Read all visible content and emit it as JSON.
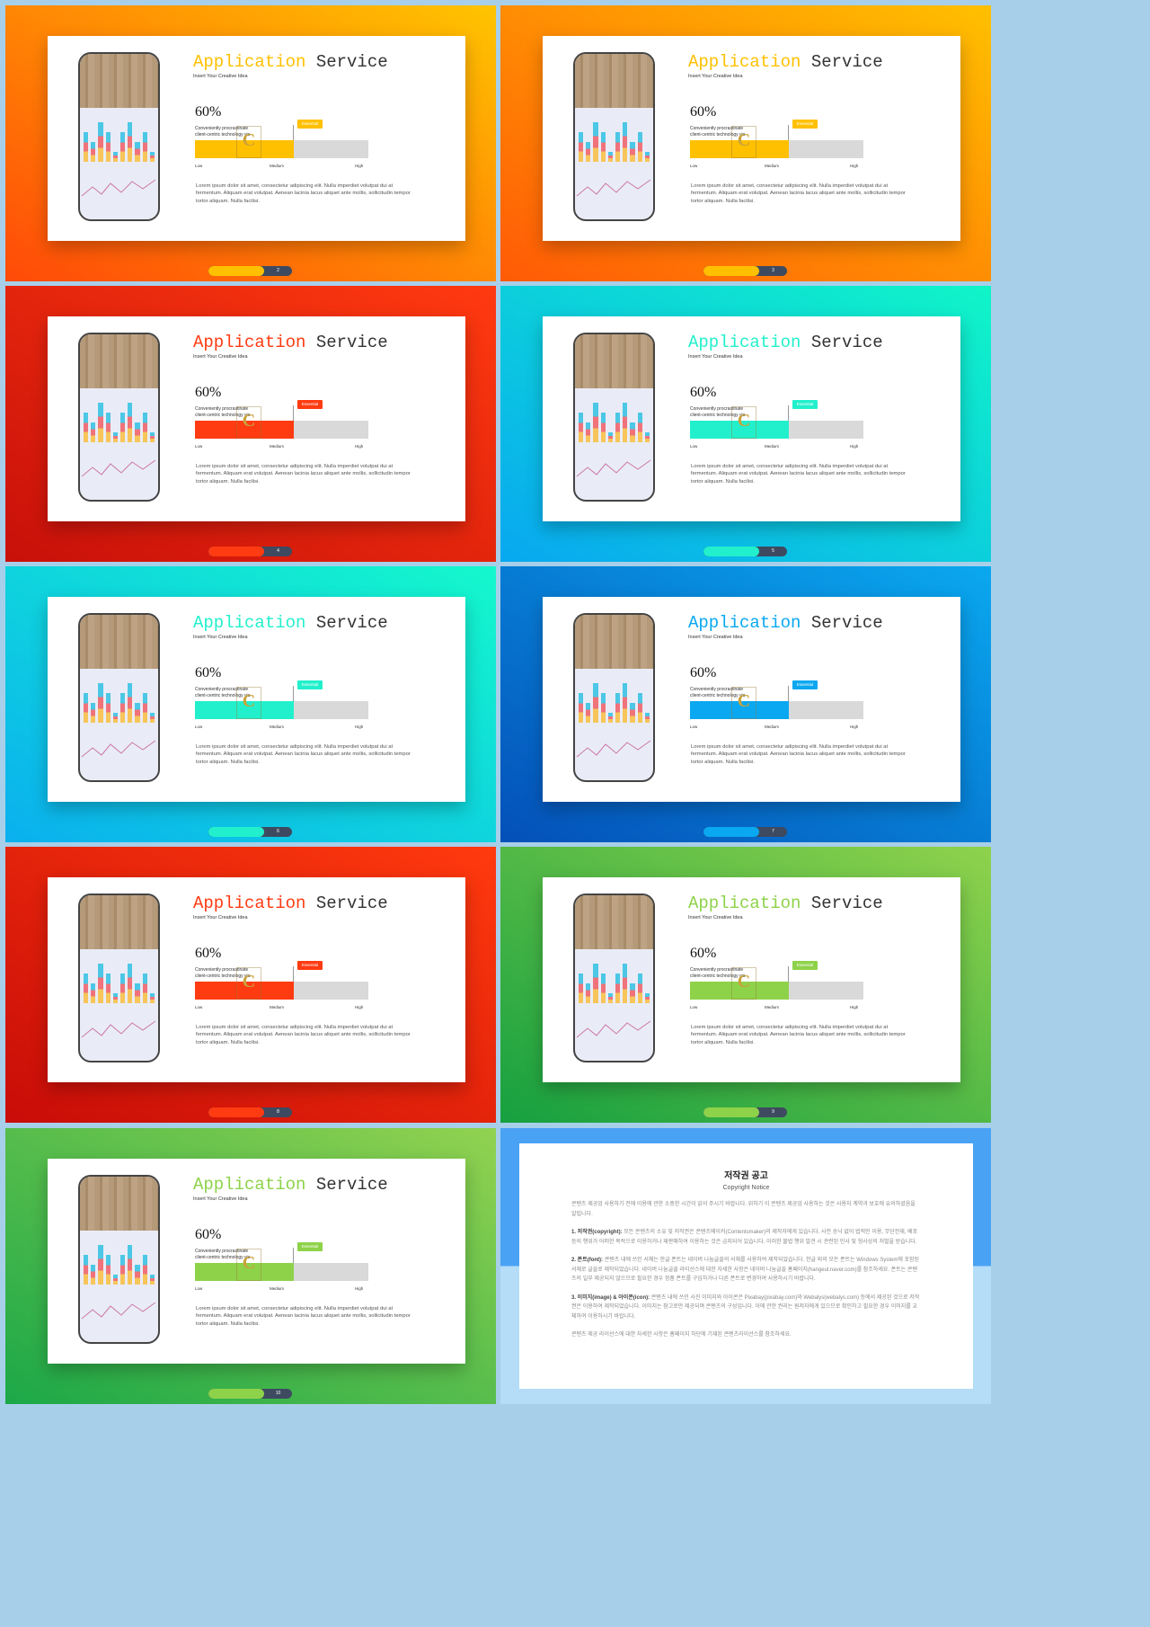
{
  "slide_template": {
    "title_accent": "Application",
    "title_rest": " Service",
    "subtitle": "Insert Your Creative Idea",
    "percent": "60%",
    "progress_percent": 57,
    "description": "Conveniently procrastinate client-centric technology via",
    "badge": "Essential",
    "scale_low": "Low",
    "scale_medium": "Medium",
    "scale_high": "High",
    "body": "Lorem ipsum dolor sit amet, consectetur adipiscing elit. Nulla imperdiet volutpat dui at fermentum. Aliquam erat volutpat. Aenean lacinia lacus aliquet ante mollis, sollicitudin tempor tortor aliquam. Nulla facilisi."
  },
  "slides": [
    {
      "page": "2",
      "accent": "#ffc000",
      "bg": [
        "#ff4a08",
        "#ffc400"
      ]
    },
    {
      "page": "3",
      "accent": "#ffc000",
      "bg": [
        "#ff5a06",
        "#ffc000"
      ]
    },
    {
      "page": "4",
      "accent": "#ff3b12",
      "bg": [
        "#c8100a",
        "#ff3a10"
      ]
    },
    {
      "page": "5",
      "accent": "#22f0cc",
      "bg": [
        "#08a8f0",
        "#10f5c8"
      ]
    },
    {
      "page": "6",
      "accent": "#22f0cc",
      "bg": [
        "#0ab0ee",
        "#14f8cc"
      ]
    },
    {
      "page": "7",
      "accent": "#0aa8f0",
      "bg": [
        "#0450b8",
        "#0aa8ef"
      ]
    },
    {
      "page": "8",
      "accent": "#ff3b12",
      "bg": [
        "#c80c08",
        "#ff3a0e"
      ]
    },
    {
      "page": "9",
      "accent": "#8ed24a",
      "bg": [
        "#16a040",
        "#8fd24c"
      ]
    },
    {
      "page": "10",
      "accent": "#8ed24a",
      "bg": [
        "#1ca848",
        "#92d250"
      ]
    }
  ],
  "notice": {
    "bg_top": "#4aa2f5",
    "bg_bottom": "#b5ddf8",
    "title": "저작권 공고",
    "subtitle": "Copyright Notice",
    "intro": "콘텐츠 제공업 사용하기 전에 이용에 관한 소중한 시간이 읽어 주시기 바랍니다. 위하기 이 콘텐츠 제공업 사용하는 것은 사용자 계약과 보호에 유의하셨음을 알립니다.",
    "items": [
      {
        "head": "1. 저작권(copyright):",
        "text": " 모든 콘텐츠의 소유 및 저작권은 콘텐츠메이커(Contentsmaker)의 제작자에게 있습니다. 사전 승낙 없이 법적인 이용, 무단전재, 배포 등의 행위가 어떠한 목적으로 이용하거나 재판매하여 이용하는 것은 금지되어 있습니다. 이러한 불법 행위 발견 시 관련된 민사 및 형사상의 처벌을 받습니다."
      },
      {
        "head": "2. 폰트(font):",
        "text": " 콘텐츠 내에 쓰인 서체는 한글 폰트는 네이버 나눔글꼴의 서체를 사용하여 제작되었습니다. 한글 외의 모든 폰트는 Windows System에 포함된 서체로 글꼴로 제작되었습니다. 네이버 나눔글꼴 라이선스에 대한 자세한 사항은 네이버 나눔글꼴 홈페이지(hangeul.naver.com)를 참조하세요. 폰트는 콘텐츠의 일부 제공되지 않으므로 필요한 경우 정품 폰트를 구입하거나 다른 폰트로 변경하여 사용하시기 바랍니다."
      },
      {
        "head": "3. 이미지(image) & 아이콘(icon):",
        "text": " 콘텐츠 내에 쓰인 사진 이미지와 아이콘은 Pixabay(pixabay.com)와 Webalys(webalys.com) 등에서 제공된 것으로 저작권은 이용하여 제작되었습니다. 이미지는 참고로만 제공되며 콘텐츠의 구성입니다. 이에 관한 권리는 원저자에게 있으므로 확인하고 필요한 경우 이미지를 교체하여 이용하시기 바랍니다."
      }
    ],
    "footer": "콘텐츠 제공 라이선스에 대한 자세한 사항은 홈페이지 하단에 기재된 콘텐츠라이선스를 참조하세요."
  }
}
